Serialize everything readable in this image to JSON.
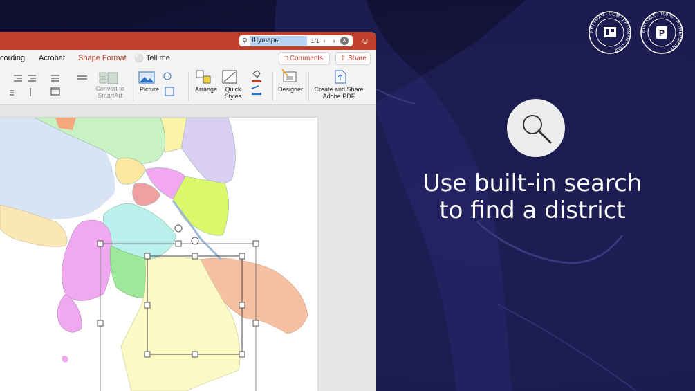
{
  "titlebar": {
    "search_query": "Шушары",
    "search_count": "1/1"
  },
  "tabs": [
    {
      "label": "cording"
    },
    {
      "label": "Acrobat"
    },
    {
      "label": "Shape Format"
    },
    {
      "label": "Tell me"
    }
  ],
  "actions": {
    "comments_label": "Comments",
    "share_label": "Share"
  },
  "ribbon": {
    "convert_smartart_label": "Convert to SmartArt",
    "picture_label": "Picture",
    "arrange_label": "Arrange",
    "quick_styles_label": "Quick Styles",
    "designer_label": "Designer",
    "create_share_pdf_label": "Create and Share Adobe PDF"
  },
  "promo": {
    "headline_line1": "Use built-in search",
    "headline_line2": "to find a district",
    "badge1_text": "PPTYMAN · COM · PPTYMAN · COM ·",
    "badge2_text": "EDITABLE · 100 % · POWERPOINT ·"
  },
  "colors": {
    "accent": "#c0412b",
    "promo_bg": "#17163f",
    "search_highlight": "#b7d3f5"
  },
  "icons": [
    "search-icon",
    "people-icon",
    "comment-icon",
    "share-icon",
    "tell-me-bulb-icon"
  ]
}
